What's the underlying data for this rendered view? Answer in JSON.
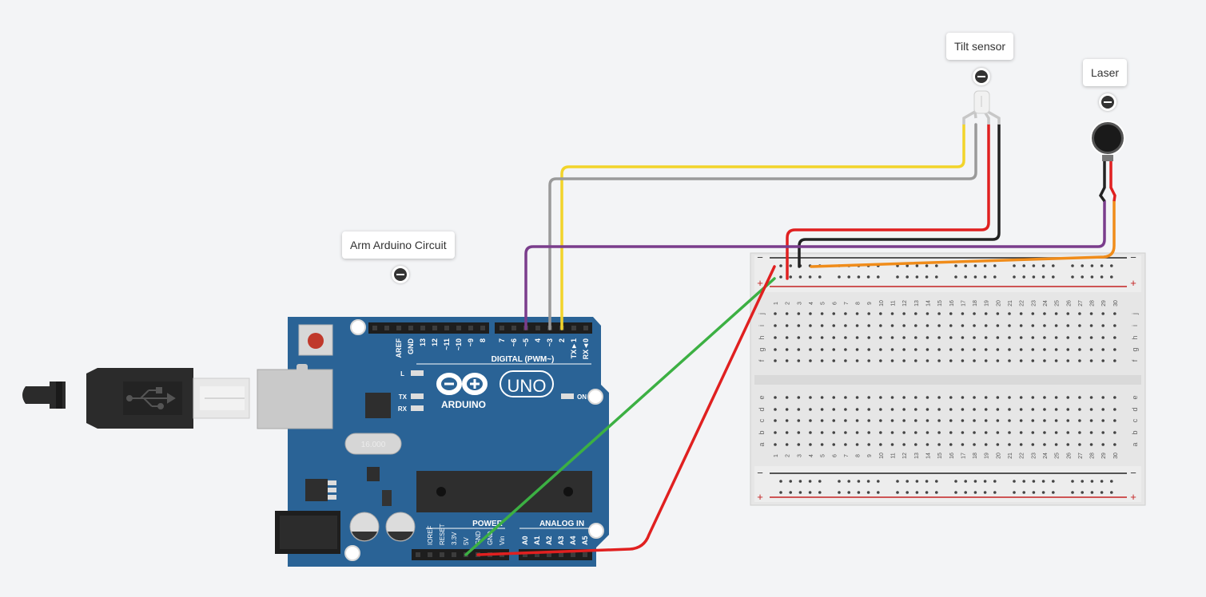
{
  "labels": {
    "arduino_tooltip": "Arm Arduino Circuit",
    "tilt_tooltip": "Tilt sensor",
    "laser_tooltip": "Laser"
  },
  "arduino": {
    "model": "UNO",
    "brand": "ARDUINO",
    "digital_header": "DIGITAL (PWM~)",
    "digital_pins": [
      "AREF",
      "GND",
      "13",
      "12",
      "~11",
      "~10",
      "~9",
      "8",
      "7",
      "~6",
      "~5",
      "4",
      "~3",
      "2",
      "TX►1",
      "RX◄0"
    ],
    "power_header": "POWER",
    "power_pins": [
      "IOREF",
      "RESET",
      "3.3V",
      "5V",
      "GND",
      "GND",
      "Vin"
    ],
    "analog_header": "ANALOG IN",
    "analog_pins": [
      "A0",
      "A1",
      "A2",
      "A3",
      "A4",
      "A5"
    ],
    "leds": [
      "L",
      "TX",
      "RX"
    ],
    "on_label": "ON",
    "crystal_label": "16.000"
  },
  "breadboard": {
    "columns": [
      "1",
      "2",
      "3",
      "4",
      "5",
      "6",
      "7",
      "8",
      "9",
      "10",
      "11",
      "12",
      "13",
      "14",
      "15",
      "16",
      "17",
      "18",
      "19",
      "20",
      "21",
      "22",
      "23",
      "24",
      "25",
      "26",
      "27",
      "28",
      "29",
      "30"
    ],
    "rows_top": [
      "j",
      "i",
      "h",
      "g",
      "f"
    ],
    "rows_bottom": [
      "e",
      "d",
      "c",
      "b",
      "a"
    ],
    "rail_minus": "−",
    "rail_plus": "+"
  },
  "colors": {
    "background": "#f3f4f6",
    "board": "#2a6396",
    "wire_yellow": "#f2d42a",
    "wire_gray": "#9a9a9a",
    "wire_red": "#e02020",
    "wire_black": "#222222",
    "wire_purple": "#7a3d8c",
    "wire_green": "#3cb043",
    "wire_orange": "#f08c1a"
  },
  "icons": {
    "collapse": "minus-circle-icon",
    "usb": "usb-icon",
    "arduino_logo": "infinity-logo-icon"
  }
}
